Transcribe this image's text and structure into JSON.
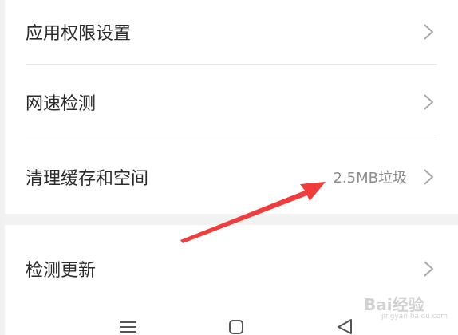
{
  "settings": {
    "rows": [
      {
        "label": "应用权限设置",
        "value": ""
      },
      {
        "label": "网速检测",
        "value": ""
      },
      {
        "label": "清理缓存和空间",
        "value": "2.5MB垃圾"
      },
      {
        "label": "检测更新",
        "value": ""
      }
    ]
  },
  "annotation": {
    "arrow_color": "#f03c3c"
  },
  "navbar": {
    "buttons": [
      "menu-icon",
      "home-icon",
      "back-icon"
    ]
  },
  "watermark": {
    "brand": "Bai经验",
    "url": "jingyan.baidu.com"
  }
}
